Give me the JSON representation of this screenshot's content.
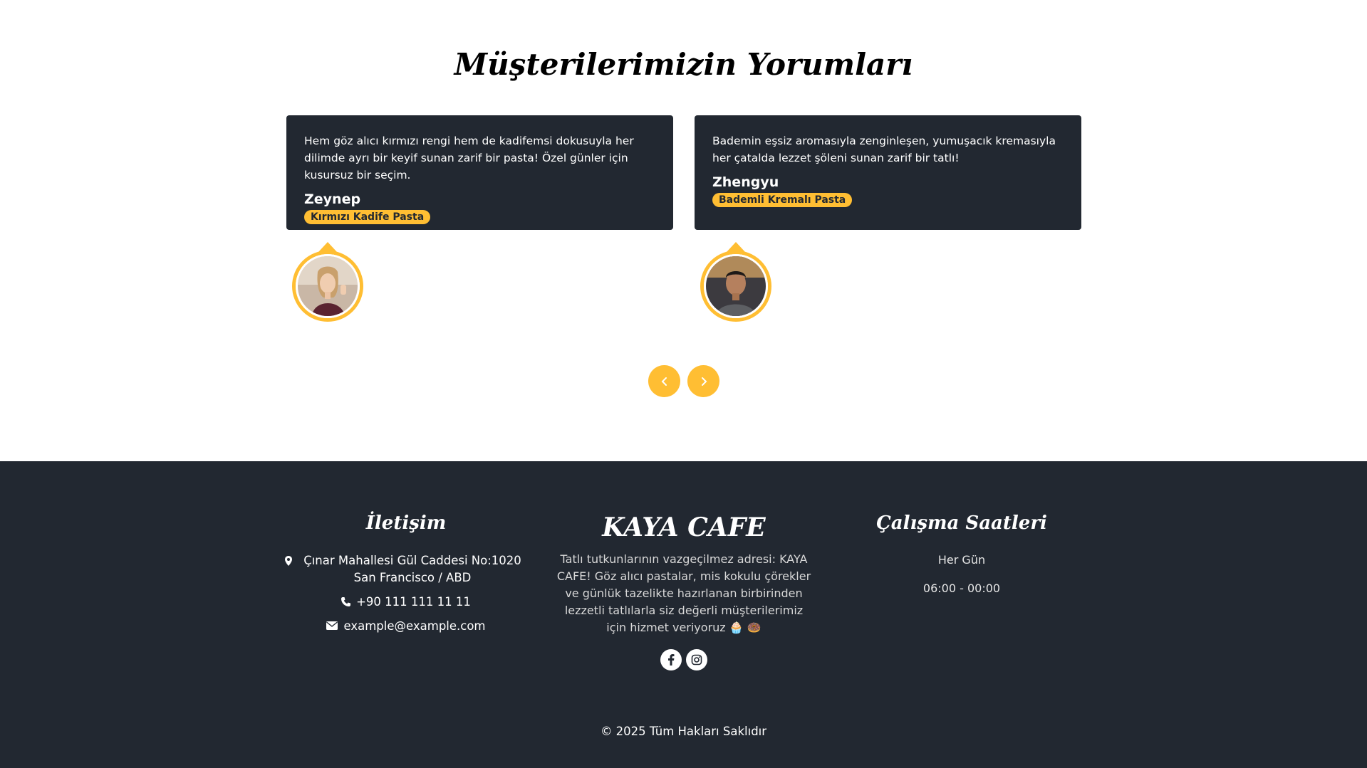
{
  "testimonials": {
    "title": "Müşterilerimizin Yorumları",
    "items": [
      {
        "text": "Hem göz alıcı kırmızı rengi hem de kadifemsi dokusuyla her dilimde ayrı bir keyif sunan zarif bir pasta! Özel günler için kusursuz bir seçim.",
        "name": "Zeynep",
        "product": "Kırmızı Kadife Pasta"
      },
      {
        "text": "Bademin eşsiz aromasıyla zenginleşen, yumuşacık kremasıyla her çatalda lezzet şöleni sunan zarif bir tatlı!",
        "name": "Zhengyu",
        "product": "Bademli Kremalı Pasta"
      }
    ],
    "nav": {
      "prev_icon": "chevron-left-icon",
      "next_icon": "chevron-right-icon"
    }
  },
  "footer": {
    "contact": {
      "title": "İletişim",
      "address": "Çınar Mahallesi Gül Caddesi No:1020 San Francisco / ABD",
      "phone": "+90 111 111 11 11",
      "email": "example@example.com"
    },
    "about": {
      "brand": "KAYA CAFE",
      "text": "Tatlı tutkunlarının vazgeçilmez adresi: KAYA CAFE! Göz alıcı pastalar, mis kokulu çörekler ve günlük tazelikte hazırlanan birbirinden lezzetli tatlılarla siz değerli müşterilerimiz için hizmet veriyoruz 🧁 🍩",
      "socials": [
        "facebook-icon",
        "instagram-icon"
      ]
    },
    "hours": {
      "title": "Çalışma Saatleri",
      "days": "Her Gün",
      "time": "06:00 - 00:00"
    },
    "copyright": "© 2025 Tüm Hakları Saklıdır"
  },
  "colors": {
    "accent": "#ffbe33",
    "dark": "#222831"
  }
}
